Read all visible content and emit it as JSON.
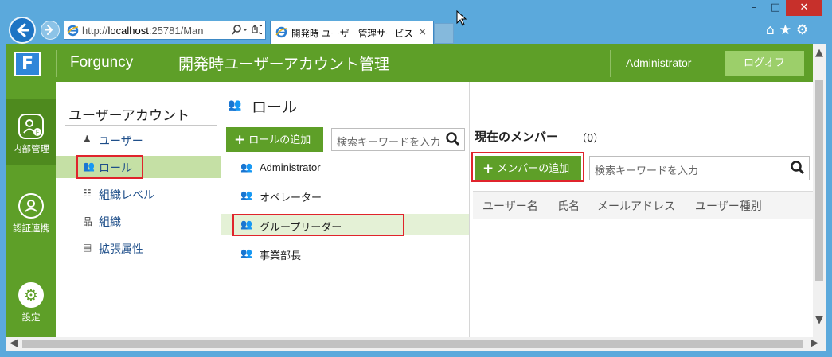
{
  "browser": {
    "url_prefix": "http://",
    "url_host": "localhost",
    "url_rest": ":25781/Man",
    "tab_title": "開発時 ユーザー管理サービス",
    "tab_close": "×",
    "icons": [
      "back-arrow-icon",
      "forward-arrow-icon",
      "ie-icon",
      "search-icon",
      "refresh-icon",
      "home-icon",
      "star-icon",
      "gear-icon"
    ],
    "window_min": "–",
    "window_max": "□",
    "window_close": "✕"
  },
  "header": {
    "logo_letter": "F",
    "brand": "Forguncy",
    "title": "開発時ユーザーアカウント管理",
    "user": "Administrator",
    "logout_label": "ログオフ",
    "color": "#5e9f28"
  },
  "left_nav": [
    {
      "label": "内部管理",
      "icon": "user-management-icon",
      "active": true
    },
    {
      "label": "認証連携",
      "icon": "user-link-icon",
      "active": false
    },
    {
      "label": "設定",
      "icon": "gear-icon",
      "active": false
    }
  ],
  "sidebar": {
    "title": "ユーザーアカウント",
    "items": [
      {
        "label": "ユーザー",
        "icon": "person-icon"
      },
      {
        "label": "ロール",
        "icon": "users-icon",
        "selected": true
      },
      {
        "label": "組織レベル",
        "icon": "hierarchy-list-icon"
      },
      {
        "label": "組織",
        "icon": "org-chart-icon"
      },
      {
        "label": "拡張属性",
        "icon": "attributes-icon"
      }
    ]
  },
  "roles": {
    "title": "ロール",
    "add_label": "ロールの追加",
    "search_placeholder": "検索キーワードを入力",
    "items": [
      {
        "label": "Administrator"
      },
      {
        "label": "オペレーター"
      },
      {
        "label": "グループリーダー",
        "selected": true
      },
      {
        "label": "事業部長"
      }
    ]
  },
  "members": {
    "title": "現在のメンバー",
    "count": "（0）",
    "add_label": "メンバーの追加",
    "search_placeholder": "検索キーワードを入力",
    "columns": [
      "ユーザー名",
      "氏名",
      "メールアドレス",
      "ユーザー種別"
    ]
  },
  "highlight_color": "#e0242c"
}
